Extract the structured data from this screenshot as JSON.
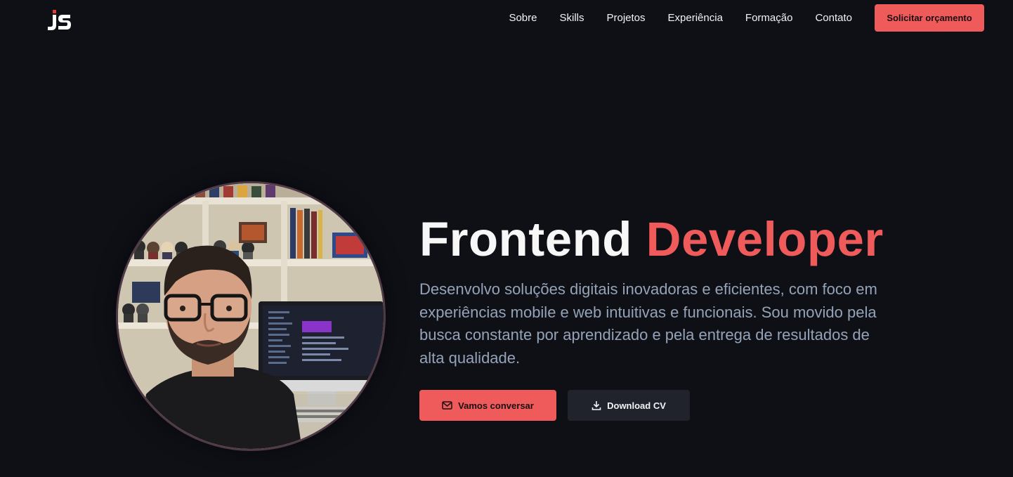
{
  "header": {
    "logo_text": "JS",
    "nav": [
      "Sobre",
      "Skills",
      "Projetos",
      "Experiência",
      "Formação",
      "Contato"
    ],
    "cta_label": "Solicitar orçamento"
  },
  "hero": {
    "title_part1": "Frontend",
    "title_part2": "Developer",
    "description": "Desenvolvo soluções digitais inovadoras e eficientes, com foco em experiências mobile e web intuitivas e funcionais. Sou movido pela busca constante por aprendizado e pela entrega de resultados de alta qualidade.",
    "primary_button": {
      "label": "Vamos conversar",
      "icon": "mail-icon"
    },
    "secondary_button": {
      "label": "Download CV",
      "icon": "download-icon"
    }
  },
  "colors": {
    "background": "#0e1016",
    "accent": "#ef5a5a",
    "text_muted": "#94a3b8",
    "secondary_button_bg": "#20232c"
  }
}
